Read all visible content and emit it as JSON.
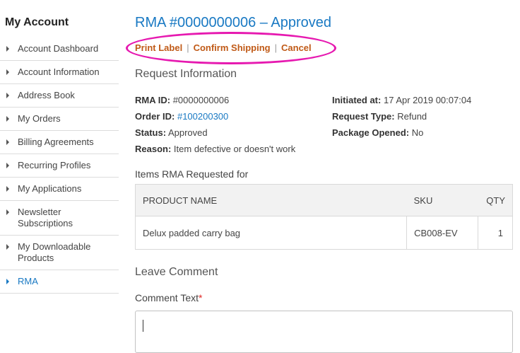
{
  "sidebar": {
    "title": "My Account",
    "items": [
      {
        "label": "Account Dashboard"
      },
      {
        "label": "Account Information"
      },
      {
        "label": "Address Book"
      },
      {
        "label": "My Orders"
      },
      {
        "label": "Billing Agreements"
      },
      {
        "label": "Recurring Profiles"
      },
      {
        "label": "My Applications"
      },
      {
        "label": "Newsletter Subscriptions"
      },
      {
        "label": "My Downloadable Products"
      },
      {
        "label": "RMA",
        "active": true
      }
    ]
  },
  "page": {
    "title": "RMA #0000000006 – Approved",
    "actions": {
      "print_label": "Print Label",
      "confirm_shipping": "Confirm Shipping",
      "cancel": "Cancel",
      "separator": "|"
    },
    "request_info": {
      "title": "Request Information",
      "rma_id_label": "RMA ID:",
      "rma_id_value": "#0000000006",
      "order_id_label": "Order ID:",
      "order_id_value": "#100200300",
      "status_label": "Status:",
      "status_value": "Approved",
      "reason_label": "Reason:",
      "reason_value": "Item defective or doesn't work",
      "initiated_label": "Initiated at:",
      "initiated_value": "17 Apr 2019 00:07:04",
      "request_type_label": "Request Type:",
      "request_type_value": "Refund",
      "package_opened_label": "Package Opened:",
      "package_opened_value": "No"
    },
    "items": {
      "title": "Items RMA Requested for",
      "columns": {
        "product": "PRODUCT NAME",
        "sku": "SKU",
        "qty": "QTY"
      },
      "rows": [
        {
          "product": "Delux padded carry bag",
          "sku": "CB008-EV",
          "qty": "1"
        }
      ]
    },
    "comment": {
      "title": "Leave Comment",
      "label": "Comment Text",
      "required_mark": "*",
      "value": ""
    }
  },
  "colors": {
    "link": "#1979c3",
    "action": "#c05a17",
    "highlight": "#e619b0",
    "required": "#e02b27"
  }
}
